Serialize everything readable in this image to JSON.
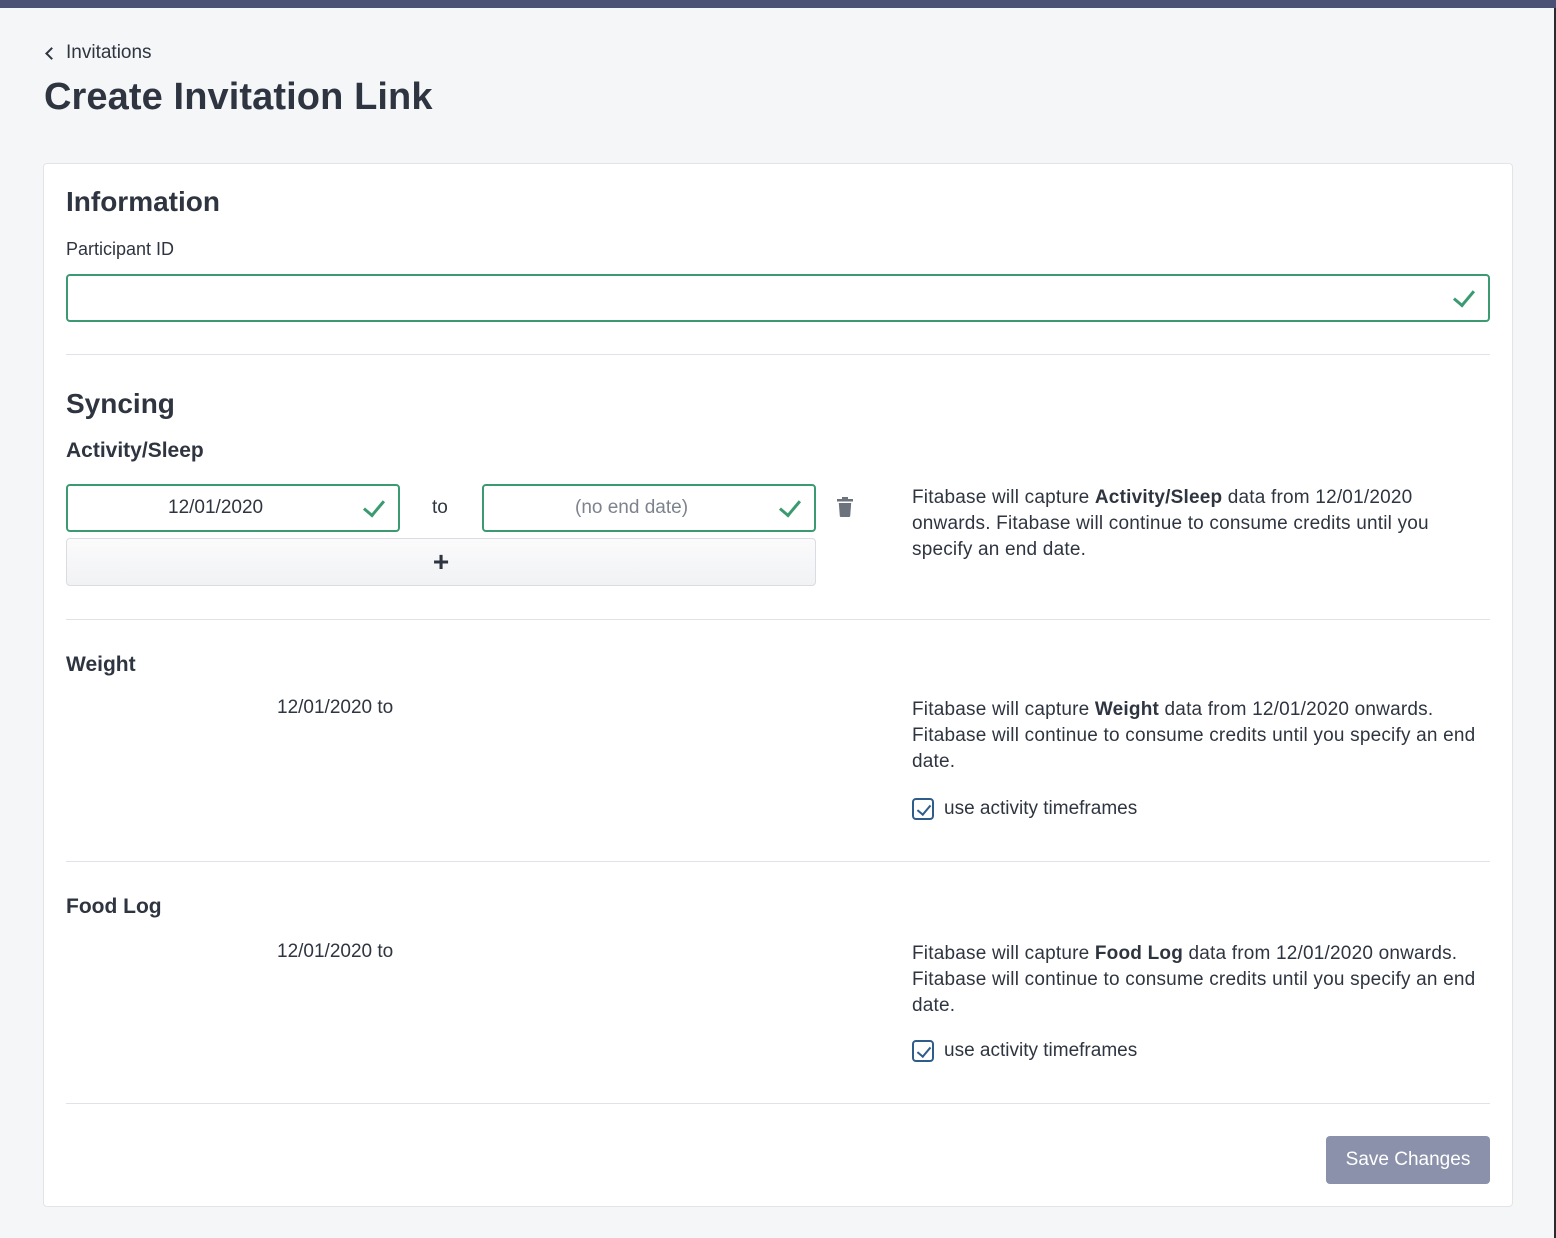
{
  "breadcrumb": {
    "back_label": "Invitations"
  },
  "page": {
    "title": "Create Invitation Link"
  },
  "information": {
    "heading": "Information",
    "participant_id_label": "Participant ID",
    "participant_id_value": ""
  },
  "syncing": {
    "heading": "Syncing",
    "activity_sleep": {
      "heading": "Activity/Sleep",
      "start_date": "12/01/2020",
      "to_label": "to",
      "end_date_placeholder": "(no end date)",
      "add_label": "+",
      "desc_prefix": "Fitabase will capture ",
      "desc_bold": "Activity/Sleep",
      "desc_suffix": " data from 12/01/2020 onwards. Fitabase will continue to consume credits until you specify an end date."
    },
    "weight": {
      "heading": "Weight",
      "range_text": "12/01/2020 to",
      "desc_prefix": "Fitabase will capture ",
      "desc_bold": "Weight",
      "desc_suffix": " data from 12/01/2020 onwards. Fitabase will continue to consume credits until you specify an end date.",
      "checkbox_label": "use activity timeframes",
      "checked": true
    },
    "food_log": {
      "heading": "Food Log",
      "range_text": "12/01/2020 to",
      "desc_prefix": "Fitabase will capture ",
      "desc_bold": "Food Log",
      "desc_suffix": " data from 12/01/2020 onwards. Fitabase will continue to consume credits until you specify an end date.",
      "checkbox_label": "use activity timeframes",
      "checked": true
    }
  },
  "actions": {
    "save_label": "Save Changes"
  },
  "colors": {
    "topbar": "#4a5174",
    "valid_green": "#3c9a72",
    "checkbox_blue": "#2f5d8a",
    "save_button": "#8b91aa"
  }
}
